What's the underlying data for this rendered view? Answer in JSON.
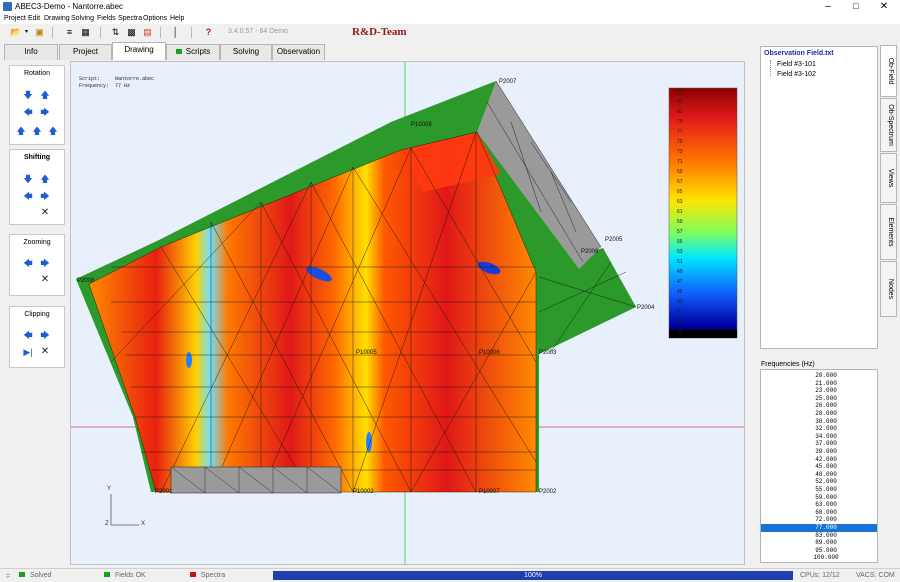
{
  "window": {
    "title": "ABEC3-Demo - Nantorre.abec"
  },
  "menu": [
    "Project",
    "Edit",
    "Drawing",
    "Solving",
    "Fields",
    "Spectra",
    "Options",
    "Help"
  ],
  "toolbar": {
    "version": "3.4.0.57 - 64 Demo",
    "brand": "R&D-Team"
  },
  "tabs": [
    {
      "label": "Info",
      "active": false,
      "indicator": false
    },
    {
      "label": "Project",
      "active": false,
      "indicator": false
    },
    {
      "label": "Drawing",
      "active": true,
      "indicator": false
    },
    {
      "label": "Scripts",
      "active": false,
      "indicator": true
    },
    {
      "label": "Solving",
      "active": false,
      "indicator": false
    },
    {
      "label": "Observation",
      "active": false,
      "indicator": false
    }
  ],
  "left_panel": {
    "rotation": {
      "title": "Rotation"
    },
    "shifting": {
      "title": "Shifting"
    },
    "zooming": {
      "title": "Zooming"
    },
    "clipping": {
      "title": "Clipping"
    }
  },
  "canvas": {
    "script_label": "Script:",
    "script_value": "Nantorre.abec",
    "frequency_label": "Frequency:",
    "frequency_value": "77 Hz",
    "axis_y": "Y",
    "axis_z": "Z",
    "axis_x": "X",
    "points": [
      "P2007",
      "P10008",
      "P2005",
      "P2006",
      "P2004",
      "P2008",
      "P10005",
      "P10006",
      "P2003",
      "P10002",
      "P10007",
      "P2002",
      "P2001"
    ],
    "colorbar_ticks": [
      "85",
      "83",
      "81",
      "79",
      "77",
      "75",
      "73",
      "71",
      "69",
      "67",
      "65",
      "63",
      "61",
      "59",
      "57",
      "55",
      "53",
      "51",
      "49",
      "47",
      "45",
      "43",
      "41",
      "39",
      "37"
    ]
  },
  "right_panel": {
    "observation_root": "Observation Field.txt",
    "fields": [
      "Field #3-101",
      "Field #3-102"
    ],
    "frequencies_label": "Frequencies  (Hz)",
    "frequencies": [
      "20.000",
      "21.000",
      "23.000",
      "25.000",
      "26.000",
      "28.000",
      "30.000",
      "32.000",
      "34.000",
      "37.000",
      "39.000",
      "42.000",
      "45.000",
      "48.000",
      "52.000",
      "55.000",
      "59.000",
      "63.000",
      "68.000",
      "72.000",
      "77.000",
      "83.000",
      "89.000",
      "95.000",
      "100.000"
    ],
    "selected_frequency": "77.000"
  },
  "side_tabs": [
    "Ob-Field",
    "Ob-Spectrum",
    "Views",
    "Elements",
    "Nodes"
  ],
  "status": {
    "solved": "Solved",
    "fields": "Fields OK",
    "spectra": "Spectra",
    "progress_text": "100%",
    "progress": 1.0,
    "cpus": "CPUs: 12/12",
    "vacs": "VACS: COM",
    "colors": {
      "solved": "#19a219",
      "fields": "#19a219",
      "spectra": "#c21818"
    }
  }
}
